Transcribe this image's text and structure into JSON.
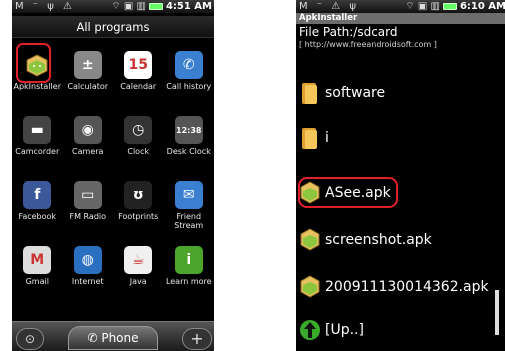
{
  "left": {
    "status": {
      "left_icons": "M ⁻ ψ ⚠",
      "right_icons": "⌔ ▣ ▥",
      "time": "4:51 AM"
    },
    "title": "All programs",
    "apps": [
      {
        "label": "ApkInstaller",
        "icon": "android-package-icon",
        "glyph": "",
        "color": "#caa040"
      },
      {
        "label": "Calculator",
        "icon": "calculator-icon",
        "glyph": "±",
        "color": "#888888"
      },
      {
        "label": "Calendar",
        "icon": "calendar-icon",
        "glyph": "15",
        "color": "#ffffff"
      },
      {
        "label": "Call history",
        "icon": "call-history-icon",
        "glyph": "✆",
        "color": "#3a7fd0"
      },
      {
        "label": "Camcorder",
        "icon": "camcorder-icon",
        "glyph": "▬",
        "color": "#444444"
      },
      {
        "label": "Camera",
        "icon": "camera-icon",
        "glyph": "◉",
        "color": "#555555"
      },
      {
        "label": "Clock",
        "icon": "clock-icon",
        "glyph": "◷",
        "color": "#333333"
      },
      {
        "label": "Desk Clock",
        "icon": "desk-clock-icon",
        "glyph": "12:38",
        "color": "#555555"
      },
      {
        "label": "Facebook",
        "icon": "facebook-icon",
        "glyph": "f",
        "color": "#3b5998"
      },
      {
        "label": "FM Radio",
        "icon": "fm-radio-icon",
        "glyph": "▭",
        "color": "#666666"
      },
      {
        "label": "Footprints",
        "icon": "footprints-icon",
        "glyph": "ʊ",
        "color": "#222222"
      },
      {
        "label": "Friend Stream",
        "icon": "friend-stream-icon",
        "glyph": "✉",
        "color": "#3a7fd0"
      },
      {
        "label": "Gmail",
        "icon": "gmail-icon",
        "glyph": "M",
        "color": "#dddddd"
      },
      {
        "label": "Internet",
        "icon": "internet-icon",
        "glyph": "◍",
        "color": "#2a6fc0"
      },
      {
        "label": "Java",
        "icon": "java-icon",
        "glyph": "☕",
        "color": "#f0f0f0"
      },
      {
        "label": "Learn more",
        "icon": "learn-more-icon",
        "glyph": "i",
        "color": "#4aa52a"
      }
    ],
    "dock": {
      "left": "⊙",
      "center": "✆ Phone",
      "right": "+"
    }
  },
  "right": {
    "status": {
      "left_icons": "M ⁻ ⚠ ψ",
      "right_icons": "⌔ ▣ ▥",
      "time": "6:10 AM"
    },
    "app_title": "ApkInstaller",
    "path": "File Path:/sdcard",
    "url": "[ http://www.freeandroidsoft.com ]",
    "files": [
      {
        "name": "software",
        "type": "folder"
      },
      {
        "name": "i",
        "type": "folder"
      },
      {
        "name": "ASee.apk",
        "type": "apk"
      },
      {
        "name": "screenshot.apk",
        "type": "apk"
      },
      {
        "name": "200911130014362.apk",
        "type": "apk"
      },
      {
        "name": "[Up..]",
        "type": "up"
      }
    ]
  }
}
